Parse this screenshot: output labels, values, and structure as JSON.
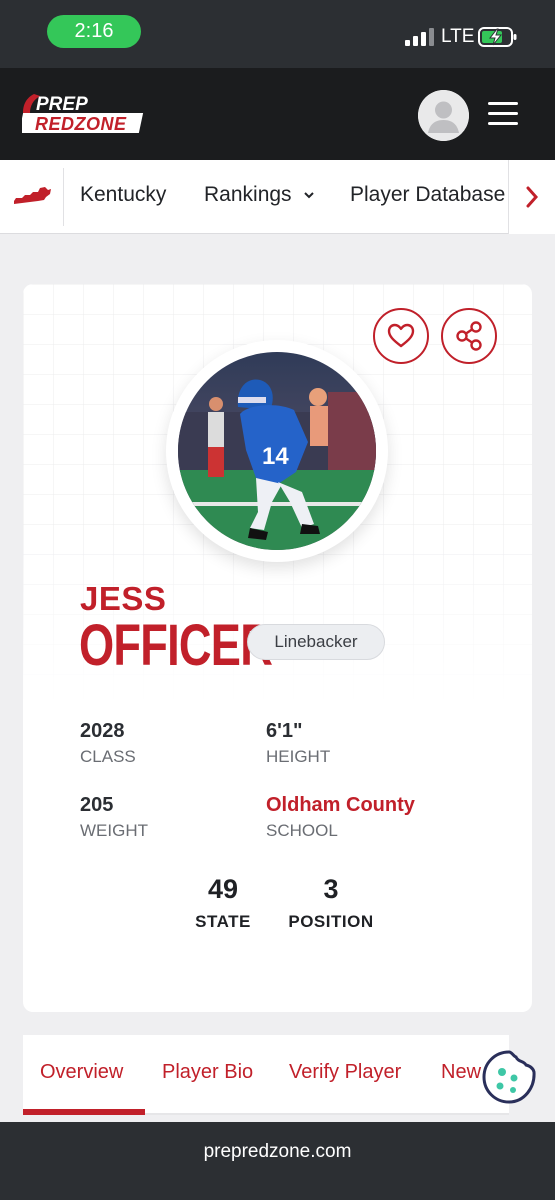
{
  "status_bar": {
    "time": "2:16",
    "network": "LTE"
  },
  "header": {
    "logo_line1": "PREP",
    "logo_line2": "REDZONE"
  },
  "nav": {
    "items": [
      {
        "label": "Kentucky"
      },
      {
        "label": "Rankings",
        "chevron": "chevron-down-icon"
      },
      {
        "label": "Player Database"
      }
    ]
  },
  "player": {
    "first_name": "JESS",
    "last_name": "OFFICER",
    "position": "Linebacker",
    "photo_jersey_number": "14",
    "stats": [
      {
        "value": "2028",
        "label": "CLASS"
      },
      {
        "value": "6'1\"",
        "label": "HEIGHT"
      },
      {
        "value": "205",
        "label": "WEIGHT"
      },
      {
        "value": "Oldham County",
        "label": "SCHOOL"
      }
    ],
    "rankings": [
      {
        "value": "49",
        "label": "STATE"
      },
      {
        "value": "3",
        "label": "POSITION"
      }
    ]
  },
  "tabs": [
    {
      "label": "Overview",
      "active": true
    },
    {
      "label": "Player Bio"
    },
    {
      "label": "Verify Player"
    },
    {
      "label": "New"
    }
  ],
  "browser": {
    "url": "prepredzone.com"
  },
  "colors": {
    "brand_red": "#c1202a",
    "status_green": "#34c759",
    "dark": "#1b1c1e"
  }
}
